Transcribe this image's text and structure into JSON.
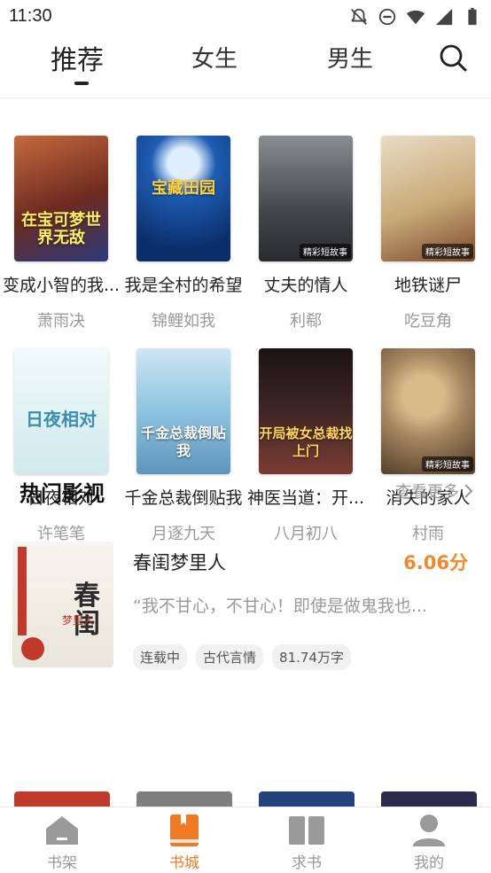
{
  "status_bar": {
    "time": "11:30",
    "icons": [
      "notifications-off-icon",
      "do-not-disturb-icon",
      "wifi-icon",
      "signal-icon",
      "battery-icon"
    ]
  },
  "top_nav": {
    "tabs": [
      {
        "label": "推荐",
        "active": true
      },
      {
        "label": "女生",
        "active": false
      },
      {
        "label": "男生",
        "active": false
      }
    ],
    "search_icon": "search-icon"
  },
  "books": [
    {
      "title": "变成小智的我...",
      "author": "萧雨决",
      "cover_text": "在宝可梦世界无敌",
      "cover_color": "#8a3c2c"
    },
    {
      "title": "我是全村的希望",
      "author": "锦鲤如我",
      "cover_text": "宝藏田园",
      "cover_color": "#1d5fb0"
    },
    {
      "title": "丈夫的情人",
      "author": "利郗",
      "cover_text": "",
      "cover_badge": "精彩短故事",
      "cover_color": "#5c5f63"
    },
    {
      "title": "地铁谜尸",
      "author": "吃豆角",
      "cover_text": "",
      "cover_badge": "精彩短故事",
      "cover_color": "#b78b58"
    },
    {
      "title": "日夜相对",
      "author": "许笔笔",
      "cover_text": "日夜相对",
      "cover_color": "#d8eef0"
    },
    {
      "title": "千金总裁倒贴我",
      "author": "月逐九天",
      "cover_text": "千金总裁倒贴我",
      "cover_color": "#8ec3df"
    },
    {
      "title": "神医当道：开...",
      "author": "八月初八",
      "cover_text": "开局被女总裁找上门",
      "cover_color": "#3a2323"
    },
    {
      "title": "消失的家人",
      "author": "村雨",
      "cover_text": "",
      "cover_badge": "精彩短故事",
      "cover_color": "#a58660"
    }
  ],
  "hot_dramas": {
    "title": "热门影视",
    "more_label": "查看更多",
    "item": {
      "title": "春闺梦里人",
      "score": "6.06分",
      "description": "“我不甘心，不甘心！即使是做鬼我也...",
      "tags": [
        "连载中",
        "古代言情",
        "81.74万字"
      ],
      "cover_text": "春闺",
      "cover_sub": "梦里人"
    },
    "peek_colors": [
      "#c0392b",
      "#7f7f7f",
      "#23427c",
      "#2b2a4a"
    ]
  },
  "bottom_bar": {
    "items": [
      {
        "label": "书架",
        "icon": "bookshelf-icon",
        "active": false
      },
      {
        "label": "书城",
        "icon": "bookstore-icon",
        "active": true
      },
      {
        "label": "求书",
        "icon": "request-book-icon",
        "active": false
      },
      {
        "label": "我的",
        "icon": "profile-icon",
        "active": false
      }
    ]
  },
  "colors": {
    "accent": "#ef7a23",
    "score": "#f08a2c",
    "muted": "#999999"
  }
}
